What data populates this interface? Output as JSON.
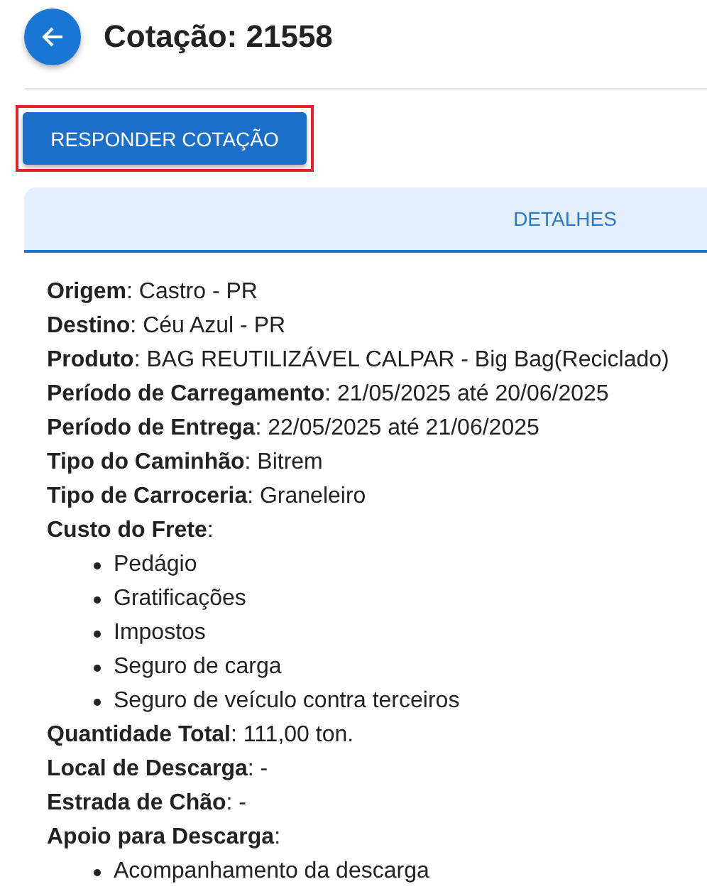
{
  "header": {
    "title": "Cotação: 21558"
  },
  "action_button": {
    "label": "RESPONDER COTAÇÃO",
    "highlighted": true
  },
  "tabs": [
    {
      "label": "DETALHES",
      "selected": true
    }
  ],
  "details": [
    {
      "text": "**Origem**: Castro - PR"
    },
    {
      "text": "**Destino**: Céu Azul - PR"
    },
    {
      "text": "**Produto**: BAG REUTILIZÁVEL CALPAR - Big Bag(Reciclado)"
    },
    {
      "text": "**Período de Carregamento**: 21/05/2025 até 20/06/2025"
    },
    {
      "text": "**Período de Entrega**: 22/05/2025 até 21/06/2025"
    },
    {
      "text": "**Tipo do Caminhão**: Bitrem"
    },
    {
      "text": "**Tipo de Carroceria**: Graneleiro"
    },
    {
      "text": "**Custo do Frete**:",
      "children": [
        "Pedágio",
        "Gratificações",
        "Impostos",
        "Seguro de carga",
        "Seguro de veículo contra terceiros"
      ]
    },
    {
      "text": "**Quantidade Total**: 111,00 ton."
    },
    {
      "text": "**Local de Descarga**: -"
    },
    {
      "text": "**Estrada de Chão**: -"
    },
    {
      "text": "**Apoio para Descarga**:",
      "children": [
        "Acompanhamento da descarga"
      ]
    }
  ]
}
